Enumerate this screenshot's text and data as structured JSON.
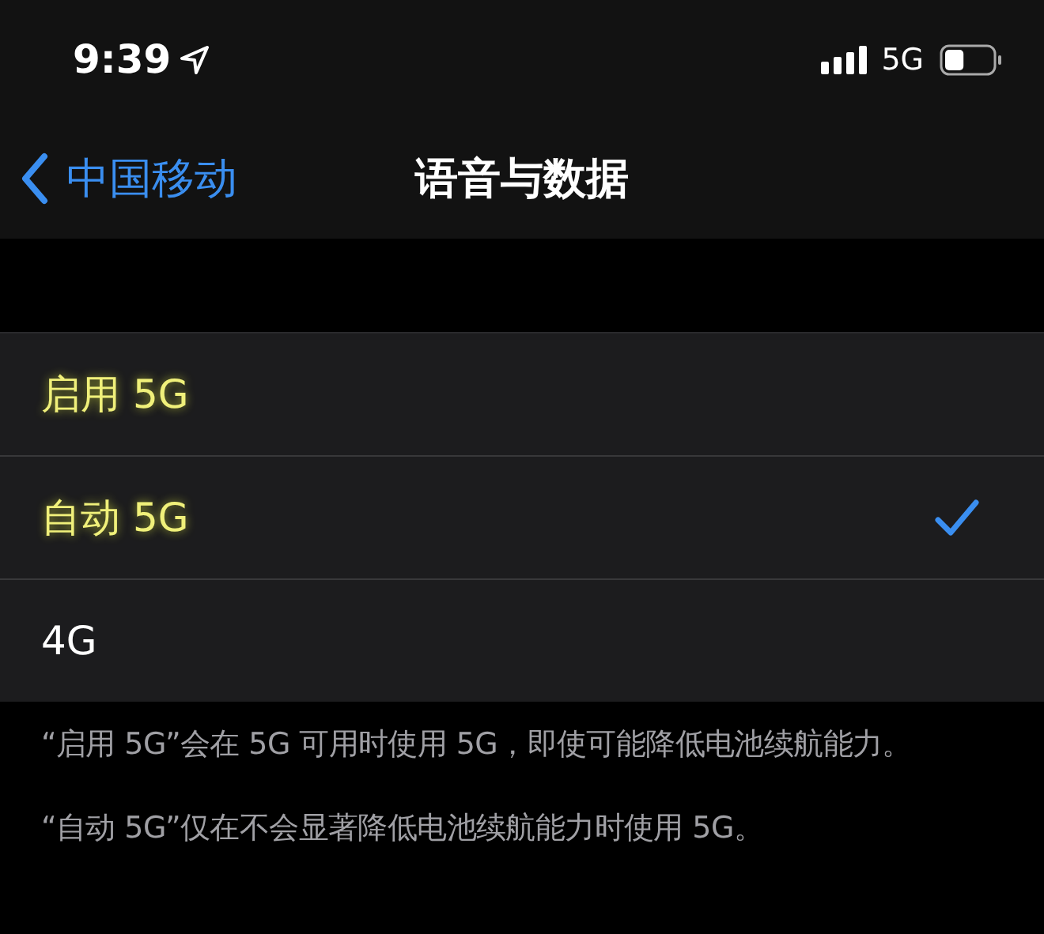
{
  "status_bar": {
    "time": "9:39",
    "network": "5G"
  },
  "nav": {
    "back_label": "中国移动",
    "title": "语音与数据"
  },
  "options": [
    {
      "label": "启用 5G",
      "selected": false,
      "highlighted": true
    },
    {
      "label": "自动 5G",
      "selected": true,
      "highlighted": true
    },
    {
      "label": "4G",
      "selected": false,
      "highlighted": false
    }
  ],
  "footer": [
    "“启用 5G”会在 5G 可用时使用 5G，即使可能降低电池续航能力。",
    "“自动 5G”仅在不会显著降低电池续航能力时使用 5G。"
  ]
}
